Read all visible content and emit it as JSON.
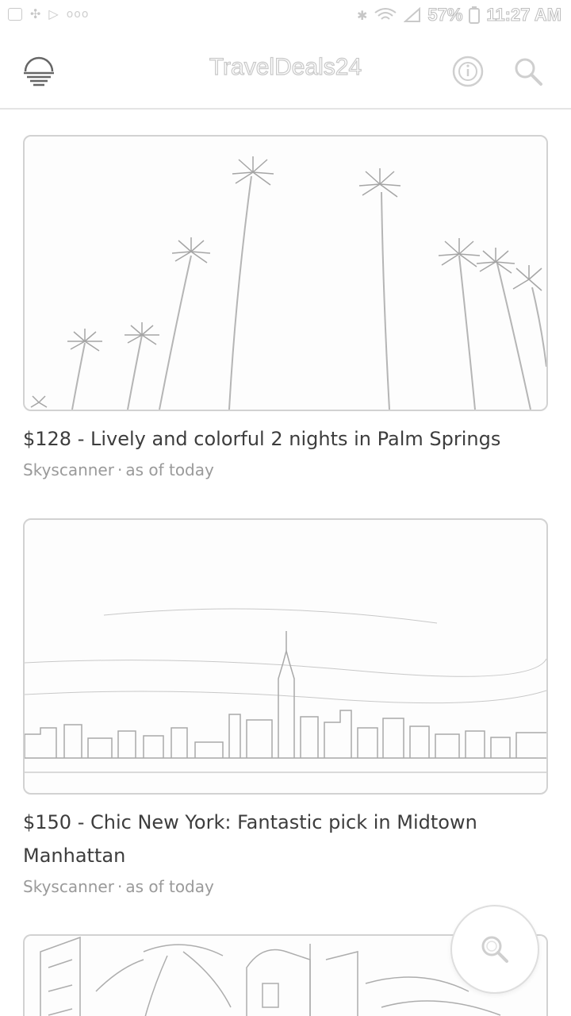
{
  "status_bar": {
    "battery": "57%",
    "time": "11:27 AM",
    "icons": [
      "notification-icon",
      "pinwheel-icon",
      "play-store-icon",
      "more-dots-icon",
      "bluetooth-icon",
      "wifi-icon",
      "signal-icon",
      "battery-icon"
    ]
  },
  "app_bar": {
    "title": "TravelDeals24",
    "logo_icon": "sunset-logo-icon",
    "info_icon": "info-icon",
    "search_icon": "search-icon"
  },
  "deals": [
    {
      "title": "$128 - Lively and colorful 2 nights in Palm Springs",
      "source": "Skyscanner",
      "separator": "·",
      "date": "as of today",
      "image": "palm-trees-image"
    },
    {
      "title": "$150 - Chic New York: Fantastic pick in Midtown Manhattan",
      "source": "Skyscanner",
      "separator": "·",
      "date": "as of today",
      "image": "new-york-skyline-image"
    },
    {
      "title": "",
      "source": "",
      "date": "",
      "image": "tropical-hotel-image"
    }
  ],
  "fab": {
    "icon": "search-icon"
  },
  "colors": {
    "line": "#c9c9c9",
    "text": "#3d3d3d",
    "meta": "#9a9a9a",
    "border": "#d2d2d2"
  }
}
